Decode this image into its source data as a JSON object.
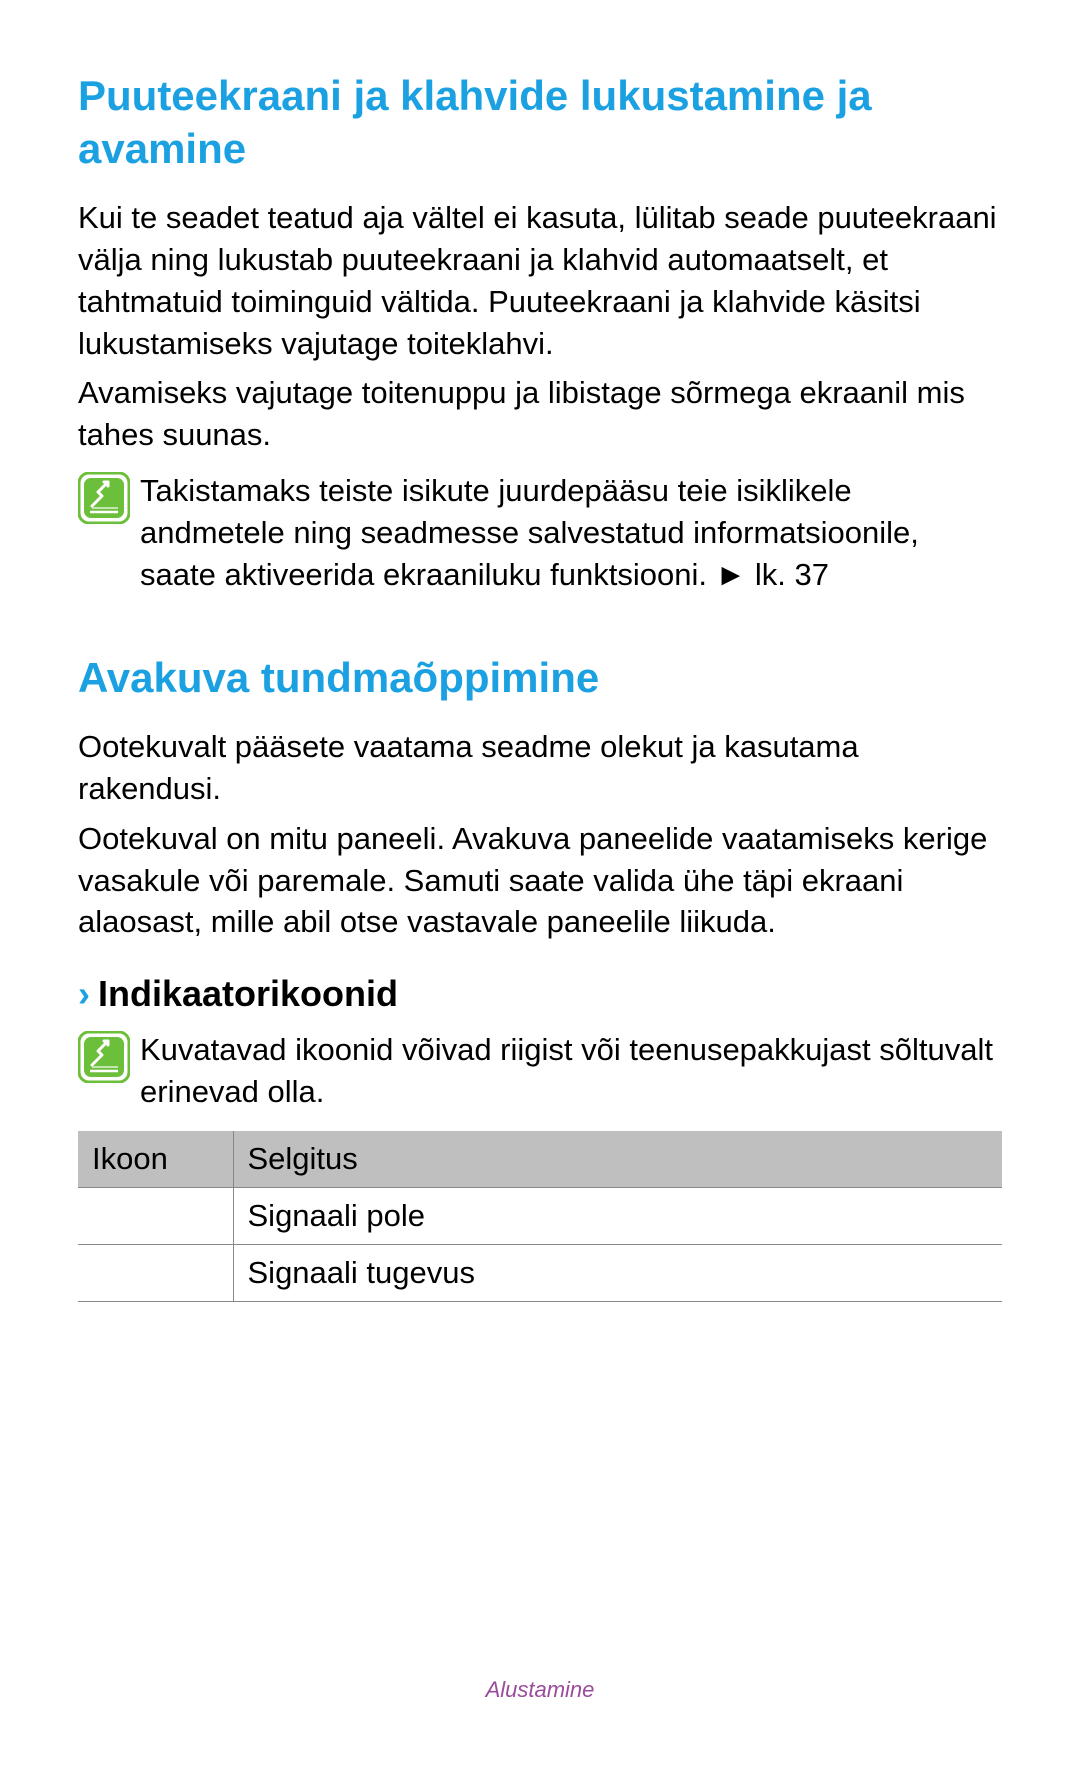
{
  "section1": {
    "heading": "Puuteekraani ja klahvide lukustamine ja avamine",
    "para1": "Kui te seadet teatud aja vältel ei kasuta, lülitab seade puuteekraani välja ning lukustab puuteekraani ja klahvid automaatselt, et tahtmatuid toiminguid vältida. Puuteekraani ja klahvide käsitsi lukustamiseks vajutage toiteklahvi.",
    "para2": "Avamiseks vajutage toitenuppu ja libistage sõrmega ekraanil mis tahes suunas.",
    "note": "Takistamaks teiste isikute juurdepääsu teie isiklikele andmetele ning seadmesse salvestatud informatsioonile, saate aktiveerida ekraaniluku funktsiooni. ► lk. 37"
  },
  "section2": {
    "heading": "Avakuva tundmaõppimine",
    "para1": "Ootekuvalt pääsete vaatama seadme olekut ja kasutama rakendusi.",
    "para2": "Ootekuval on mitu paneeli. Avakuva paneelide vaatamiseks kerige vasakule või paremale. Samuti saate valida ühe täpi ekraani alaosast, mille abil otse vastavale paneelile liikuda.",
    "subheading": "Indikaatorikoonid",
    "note": "Kuvatavad ikoonid võivad riigist või teenusepakkujast sõltuvalt erinevad olla.",
    "table": {
      "header_icon": "Ikoon",
      "header_desc": "Selgitus",
      "rows": [
        {
          "icon": "",
          "desc": "Signaali pole"
        },
        {
          "icon": "",
          "desc": "Signaali tugevus"
        }
      ]
    }
  },
  "footer": "Alustamine"
}
